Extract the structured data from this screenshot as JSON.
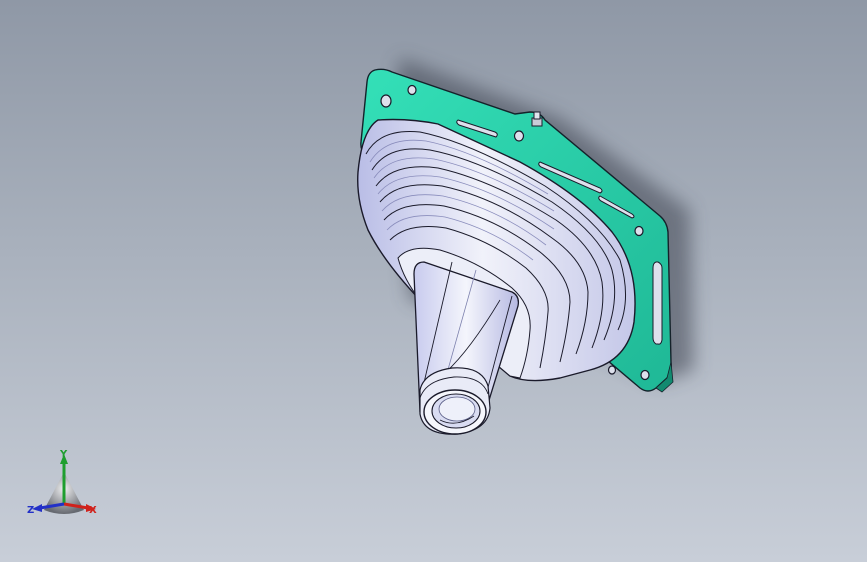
{
  "viewport": {
    "background_top": "#8f98a6",
    "background_bottom": "#c8ced8"
  },
  "model": {
    "gasket_color": "#2ad6ae",
    "boot_color": "#e6e8f4",
    "edge_color": "#1a1a2a"
  },
  "triad": {
    "x_label": "X",
    "y_label": "Y",
    "z_label": "Z",
    "x_color": "#d0221c",
    "y_color": "#1e9e2e",
    "z_color": "#2230c8"
  }
}
